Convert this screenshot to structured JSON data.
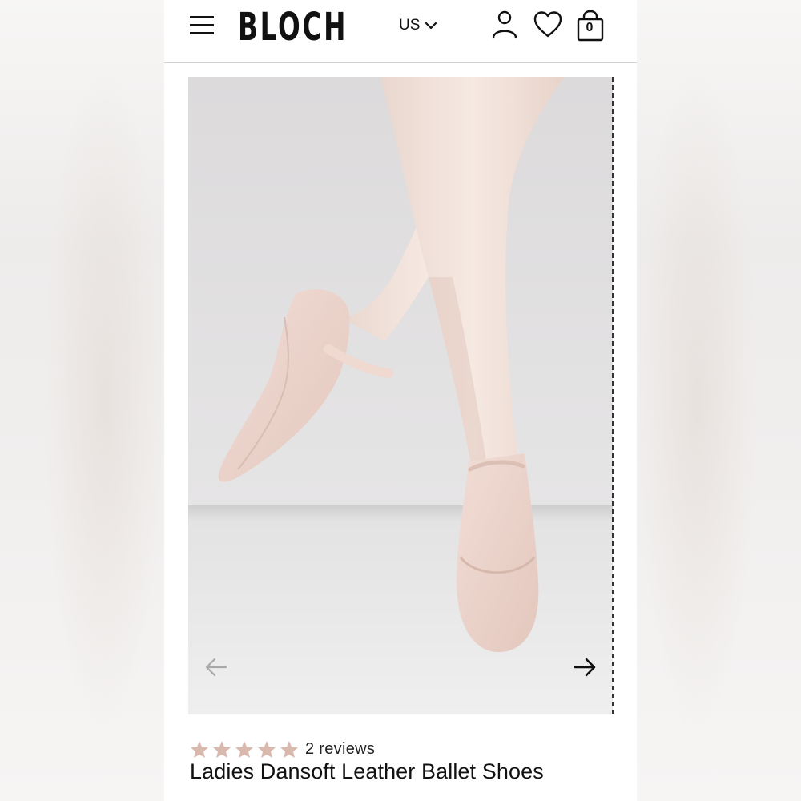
{
  "header": {
    "logo": "BLOCH",
    "region": "US",
    "cart_count": "0"
  },
  "icons": {
    "menu": "hamburger-menu-icon",
    "region_dropdown": "chevron-down-icon",
    "account": "user-icon",
    "wishlist": "heart-icon",
    "cart": "shopping-bag-icon",
    "prev": "arrow-left-icon",
    "next": "arrow-right-icon",
    "star": "star-icon"
  },
  "gallery": {
    "image_description": "ballet dancer legs in pink tights wearing pink leather ballet shoes",
    "prev_enabled": false,
    "next_enabled": true
  },
  "product": {
    "rating": 5,
    "rating_max": 5,
    "reviews_text": "2 reviews",
    "title": "Ladies Dansoft Leather Ballet Shoes"
  },
  "colors": {
    "star": "#d9b8ad",
    "text": "#111111",
    "background": "#ffffff",
    "header_border": "#cfcfcf"
  }
}
